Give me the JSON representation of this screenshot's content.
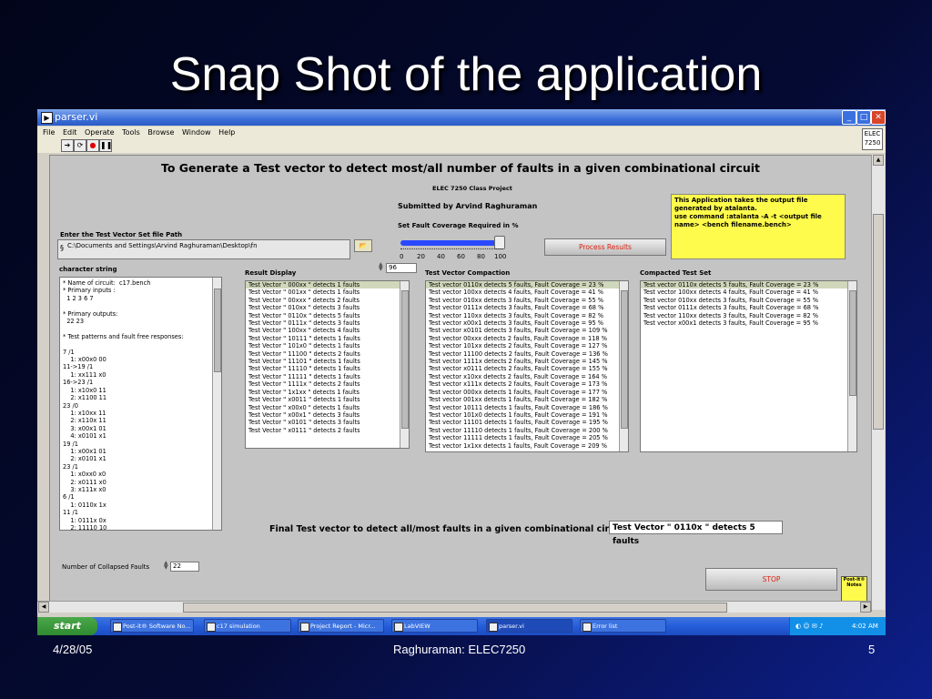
{
  "slide": {
    "title": "Snap Shot of the application",
    "date": "4/28/05",
    "footer_center": "Raghuraman: ELEC7250",
    "page": "5"
  },
  "window": {
    "title": "parser.vi",
    "icon": "run-icon",
    "elec_label_1": "ELEC",
    "elec_label_2": "7250"
  },
  "menu": [
    "File",
    "Edit",
    "Operate",
    "Tools",
    "Browse",
    "Window",
    "Help"
  ],
  "panel": {
    "heading": "To Generate  a Test vector to detect most/all number of faults in a given combinational circuit",
    "class_project": "ELEC 7250 Class Project",
    "submitted_by": "Submitted by Arvind Raghuraman",
    "fault_coverage_label": "Set Fault Coverage Required in %",
    "info_text": [
      "This Application takes the output file generated by atalanta.",
      "use command :atalanta -A -t <output file name> <bench filename.bench>"
    ],
    "path_label": "Enter the Test Vector Set file Path",
    "path_value": "C:\\Documents and Settings\\Arvind Raghuraman\\Desktop\\fn",
    "process_button": "Process Results",
    "slider_ticks": [
      "0",
      "20",
      "40",
      "60",
      "80",
      "100"
    ],
    "slider_value": 96,
    "coverage_value": "96",
    "character_string_label": "character string",
    "character_string": "* Name of circuit:  c17.bench\n* Primary inputs :\n  1 2 3 6 7\n\n* Primary outputs:\n  22 23\n\n* Test patterns and fault free responses:\n\n7 /1\n    1: x00x0 00\n11->19 /1\n    1: xx111 x0\n16->23 /1\n    1: x10x0 11\n    2: x1100 11\n23 /0\n    1: x10xx 11\n    2: x110x 11\n    3: x00x1 01\n    4: x0101 x1\n19 /1\n    1: x00x1 01\n    2: x0101 x1\n23 /1\n    1: x0xx0 x0\n    2: x0111 x0\n    3: x111x x0\n6 /1\n    1: 0110x 1x\n11 /1\n    1: 0111x 0x\n    2: 11110 10",
    "result_display_label": "Result Display",
    "result_display": [
      "Test Vector \" 000xx \" detects 1 faults",
      "Test Vector \" 001xx \" detects 1 faults",
      "Test Vector \" 00xxx \" detects 2 faults",
      "Test Vector \" 010xx \" detects 3 faults",
      "Test Vector \" 0110x \" detects 5 faults",
      "Test Vector \" 0111x \" detects 3 faults",
      "Test Vector \" 100xx \" detects 4 faults",
      "Test Vector \" 10111 \" detects 1 faults",
      "Test Vector \" 101x0 \" detects 1 faults",
      "Test Vector \" 11100 \" detects 2 faults",
      "Test Vector \" 11101 \" detects 1 faults",
      "Test Vector \" 11110 \" detects 1 faults",
      "Test Vector \" 11111 \" detects 1 faults",
      "Test Vector \" 1111x \" detects 2 faults",
      "Test Vector \" 1x1xx \" detects 1 faults",
      "Test Vector \" x0011 \" detects 1 faults",
      "Test Vector \" x00x0 \" detects 1 faults",
      "Test Vector \" x00x1 \" detects 3 faults",
      "Test Vector \" x0101 \" detects 3 faults",
      "Test Vector \" x0111 \" detects 2 faults"
    ],
    "compaction_label": "Test Vector Compaction",
    "compaction": [
      "Test vector 0110x detects 5 faults, Fault Coverage = 23 %",
      "Test vector 100xx detects 4 faults, Fault Coverage = 41 %",
      "Test vector 010xx detects 3 faults, Fault Coverage = 55 %",
      "Test vector 0111x detects 3 faults, Fault Coverage = 68 %",
      "Test vector 110xx detects 3 faults, Fault Coverage = 82 %",
      "Test vector x00x1 detects 3 faults, Fault Coverage = 95 %",
      "Test vector x0101 detects 3 faults, Fault Coverage = 109 %",
      "Test vector 00xxx detects 2 faults, Fault Coverage = 118 %",
      "Test vector 101xx detects 2 faults, Fault Coverage = 127 %",
      "Test vector 11100 detects 2 faults, Fault Coverage = 136 %",
      "Test vector 1111x detects 2 faults, Fault Coverage = 145 %",
      "Test vector x0111 detects 2 faults, Fault Coverage = 155 %",
      "Test vector x10xx detects 2 faults, Fault Coverage = 164 %",
      "Test vector x111x detects 2 faults, Fault Coverage = 173 %",
      "Test vector 000xx detects 1 faults, Fault Coverage = 177 %",
      "Test vector 001xx detects 1 faults, Fault Coverage = 182 %",
      "Test vector 10111 detects 1 faults, Fault Coverage = 186 %",
      "Test vector 101x0 detects 1 faults, Fault Coverage = 191 %",
      "Test vector 11101 detects 1 faults, Fault Coverage = 195 %",
      "Test vector 11110 detects 1 faults, Fault Coverage = 200 %",
      "Test vector 11111 detects 1 faults, Fault Coverage = 205 %",
      "Test vector 1x1xx detects 1 faults, Fault Coverage = 209 %"
    ],
    "compacted_label": "Compacted Test Set",
    "compacted": [
      "Test vector 0110x detects 5 faults, Fault Coverage = 23 %",
      "Test vector 100xx detects 4 faults, Fault Coverage = 41 %",
      "Test vector 010xx detects 3 faults, Fault Coverage = 55 %",
      "Test vector 0111x detects 3 faults, Fault Coverage = 68 %",
      "Test vector 110xx detects 3 faults, Fault Coverage = 82 %",
      "Test vector x00x1 detects 3 faults, Fault Coverage = 95 %"
    ],
    "final_label": "Final Test vector to detect all/most faults in a given combinational circuit =",
    "final_value": "Test Vector \" 0110x \" detects 5 faults",
    "collapsed_label": "Number of Collapsed Faults",
    "collapsed_value": "22",
    "stop_button": "STOP",
    "postit": "Post-it® Notes"
  },
  "taskbar": {
    "start": "start",
    "tasks": [
      "Post-it® Software No...",
      "c17 simulation",
      "Project Report - Micr...",
      "LabVIEW",
      "parser.vi",
      "Error list"
    ],
    "clock": "4:02 AM"
  }
}
